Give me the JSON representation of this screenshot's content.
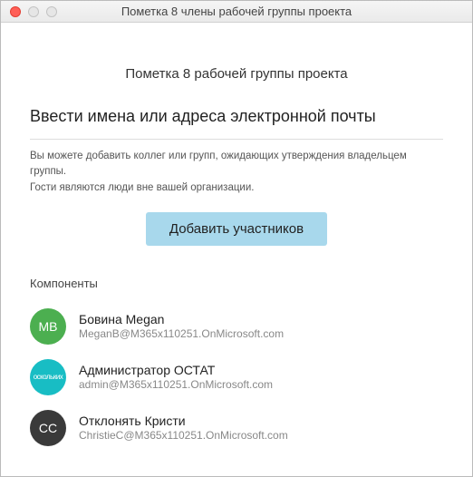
{
  "window": {
    "title": "Пометка 8 члены рабочей группы проекта"
  },
  "heading": "Пометка 8 рабочей группы проекта",
  "subheading": "Ввести имена или адреса электронной почты",
  "helptext_line1": "Вы можете добавить коллег или групп, ожидающих утверждения владельцем группы.",
  "helptext_line2": "Гости являются люди вне вашей организации.",
  "add_button": "Добавить участников",
  "section_label": "Компоненты",
  "members": [
    {
      "initials": "MB",
      "avatar_bg": "#4caf50",
      "avatar_text": "MB",
      "name": "Бовина Megan",
      "email": "MeganB@M365x110251.OnMicrosoft.com"
    },
    {
      "initials": "",
      "avatar_bg": "#18bdc4",
      "avatar_text": "оскольких",
      "avatar_is_label": true,
      "name": "Администратор ОСТАТ",
      "email": "admin@M365x110251.OnMicrosoft.com"
    },
    {
      "initials": "CC",
      "avatar_bg": "#3a3a3a",
      "avatar_text": "CC",
      "name": "Отклонять Кристи",
      "email": "ChristieC@M365x110251.OnMicrosoft.com"
    }
  ]
}
